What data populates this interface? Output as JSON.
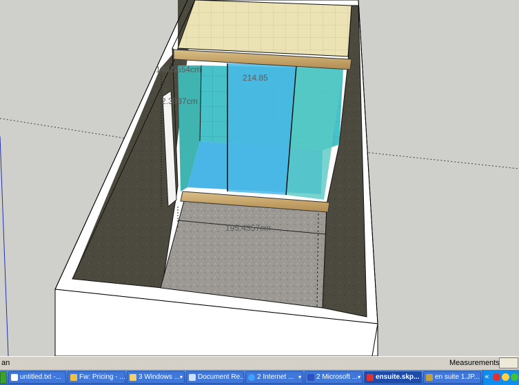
{
  "viewport": {
    "dimensions": {
      "top_width": "149.5554cm",
      "side_height": "2.3937cm",
      "back_width": "214.85",
      "floor_width": "195.4357cm"
    }
  },
  "statusbar": {
    "status_text": "an",
    "measurements_label": "Measurements",
    "measurements_value": ""
  },
  "taskbar": {
    "items": [
      {
        "label": "",
        "icon": "windows-start-icon",
        "color": "#5bbf3c"
      },
      {
        "label": "untitled.txt -...",
        "icon": "notepad-icon",
        "color": "#ffffff"
      },
      {
        "label": "Fw: Pricing - ...",
        "icon": "email-icon",
        "color": "#f0c040"
      },
      {
        "label": "3 Windows ...",
        "icon": "folder-icon",
        "color": "#f0d070"
      },
      {
        "label": "Document Re...",
        "icon": "document-icon",
        "color": "#d0e0ff"
      },
      {
        "label": "2 Internet ...",
        "icon": "internet-explorer-icon",
        "color": "#40a0ff"
      },
      {
        "label": "2 Microsoft ...",
        "icon": "word-icon",
        "color": "#3050c0"
      },
      {
        "label": "ensuite.skp...",
        "icon": "sketchup-icon",
        "color": "#e03030"
      },
      {
        "label": "en suite 1.JP...",
        "icon": "image-viewer-icon",
        "color": "#c0a040"
      }
    ],
    "tray": {
      "chevron": "«",
      "icons": [
        "security-icon",
        "network-icon",
        "volume-icon"
      ],
      "colors": [
        "#e03030",
        "#ffd040",
        "#40c040"
      ]
    }
  }
}
